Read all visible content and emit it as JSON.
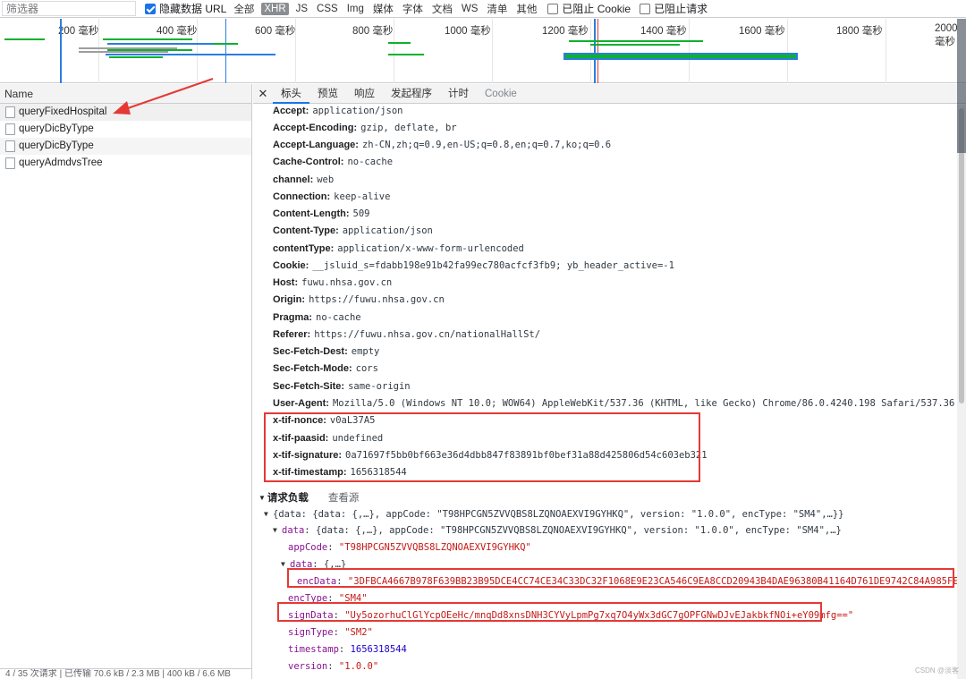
{
  "toolbar": {
    "filter_placeholder": "筛选器",
    "hide_data_urls_label": "隐藏数据 URL",
    "types": [
      "全部",
      "XHR",
      "JS",
      "CSS",
      "Img",
      "媒体",
      "字体",
      "文档",
      "WS",
      "清单",
      "其他"
    ],
    "active_type": "XHR",
    "blocked_cookies_label": "已阻止 Cookie",
    "blocked_requests_label": "已阻止请求"
  },
  "overview": {
    "ticks": [
      "200 毫秒",
      "400 毫秒",
      "600 毫秒",
      "800 毫秒",
      "1000 毫秒",
      "1200 毫秒",
      "1400 毫秒",
      "1600 毫秒",
      "1800 毫秒",
      "2000 毫秒"
    ]
  },
  "requests": {
    "header": "Name",
    "items": [
      "queryFixedHospital",
      "queryDicByType",
      "queryDicByType",
      "queryAdmdvsTree"
    ],
    "status_text": "4 / 35 次请求 | 已传输 70.6 kB / 2.3 MB | 400 kB / 6.6 MB"
  },
  "detail": {
    "tabs": [
      "标头",
      "预览",
      "响应",
      "发起程序",
      "计时",
      "Cookie"
    ],
    "active_tab": "标头",
    "headers": [
      {
        "k": "Accept:",
        "v": "application/json"
      },
      {
        "k": "Accept-Encoding:",
        "v": "gzip, deflate, br"
      },
      {
        "k": "Accept-Language:",
        "v": "zh-CN,zh;q=0.9,en-US;q=0.8,en;q=0.7,ko;q=0.6"
      },
      {
        "k": "Cache-Control:",
        "v": "no-cache"
      },
      {
        "k": "channel:",
        "v": "web"
      },
      {
        "k": "Connection:",
        "v": "keep-alive"
      },
      {
        "k": "Content-Length:",
        "v": "509"
      },
      {
        "k": "Content-Type:",
        "v": "application/json"
      },
      {
        "k": "contentType:",
        "v": "application/x-www-form-urlencoded"
      },
      {
        "k": "Cookie:",
        "v": "__jsluid_s=fdabb198e91b42fa99ec780acfcf3fb9; yb_header_active=-1"
      },
      {
        "k": "Host:",
        "v": "fuwu.nhsa.gov.cn"
      },
      {
        "k": "Origin:",
        "v": "https://fuwu.nhsa.gov.cn"
      },
      {
        "k": "Pragma:",
        "v": "no-cache"
      },
      {
        "k": "Referer:",
        "v": "https://fuwu.nhsa.gov.cn/nationalHallSt/"
      },
      {
        "k": "Sec-Fetch-Dest:",
        "v": "empty"
      },
      {
        "k": "Sec-Fetch-Mode:",
        "v": "cors"
      },
      {
        "k": "Sec-Fetch-Site:",
        "v": "same-origin"
      },
      {
        "k": "User-Agent:",
        "v": "Mozilla/5.0 (Windows NT 10.0; WOW64) AppleWebKit/537.36 (KHTML, like Gecko) Chrome/86.0.4240.198 Safari/537.36"
      },
      {
        "k": "x-tif-nonce:",
        "v": "v0aL37A5"
      },
      {
        "k": "x-tif-paasid:",
        "v": "undefined"
      },
      {
        "k": "x-tif-signature:",
        "v": "0a71697f5bb0bf663e36d4dbb847f83891bf0bef31a88d425806d54c603eb321"
      },
      {
        "k": "x-tif-timestamp:",
        "v": "1656318544"
      }
    ],
    "payload_title": "请求负载",
    "view_source": "查看源",
    "payload": {
      "root": "{data: {data: {,…}, appCode: \"T98HPCGN5ZVVQBS8LZQNOAEXVI9GYHKQ\", version: \"1.0.0\", encType: \"SM4\",…}}",
      "data_line": "{data: {,…}, appCode: \"T98HPCGN5ZVVQBS8LZQNOAEXVI9GYHKQ\", version: \"1.0.0\", encType: \"SM4\",…}",
      "appCode": "\"T98HPCGN5ZVVQBS8LZQNOAEXVI9GYHKQ\"",
      "inner_data": "{,…}",
      "encData": "\"3DFBCA4667B978F639BB23B95DCE4CC74CE34C33DC32F1068E9E23CA546C9EA8CCD20943B4DAE96380B41164D761DE9742C84A985FE3BABC310",
      "encType": "\"SM4\"",
      "signData": "\"Uy5ozorhuClGlYcpOEeHc/mnqDd8xnsDNH3CYVyLpmPg7xq7O4yWx3dGC7gOPFGNwDJvEJakbkfNOi+eY09mfg==\"",
      "signType": "\"SM2\"",
      "timestamp": "1656318544",
      "version": "\"1.0.0\""
    },
    "watermark": "CSDN @淡客"
  },
  "colors": {
    "highlight_red": "#e53935",
    "active_blue": "#1a73e8",
    "waterfall_green": "#0cb12e",
    "waterfall_blue": "#2a7ee0"
  }
}
